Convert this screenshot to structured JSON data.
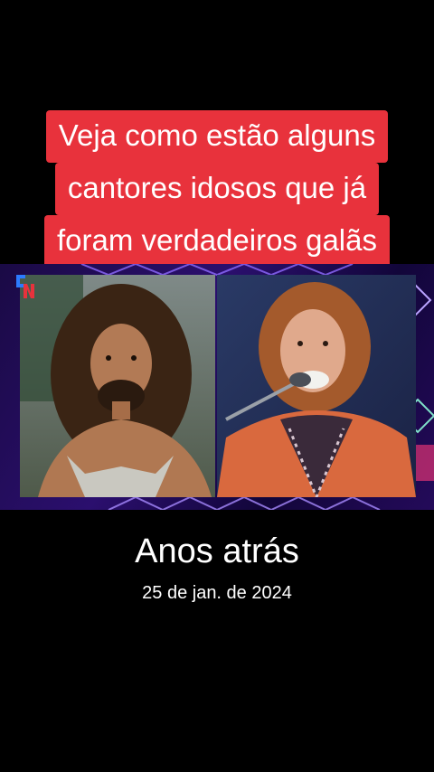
{
  "headline": {
    "lines": [
      "Veja como estão alguns",
      "cantores idosos que já",
      "foram verdadeiros galãs"
    ],
    "background_color": "#e8323c"
  },
  "images": {
    "left": "photo-young-singer",
    "right": "photo-elderly-singer",
    "logo": "channel-logo-icon"
  },
  "caption": {
    "title": "Anos atrás",
    "date": "25 de jan. de 2024"
  }
}
